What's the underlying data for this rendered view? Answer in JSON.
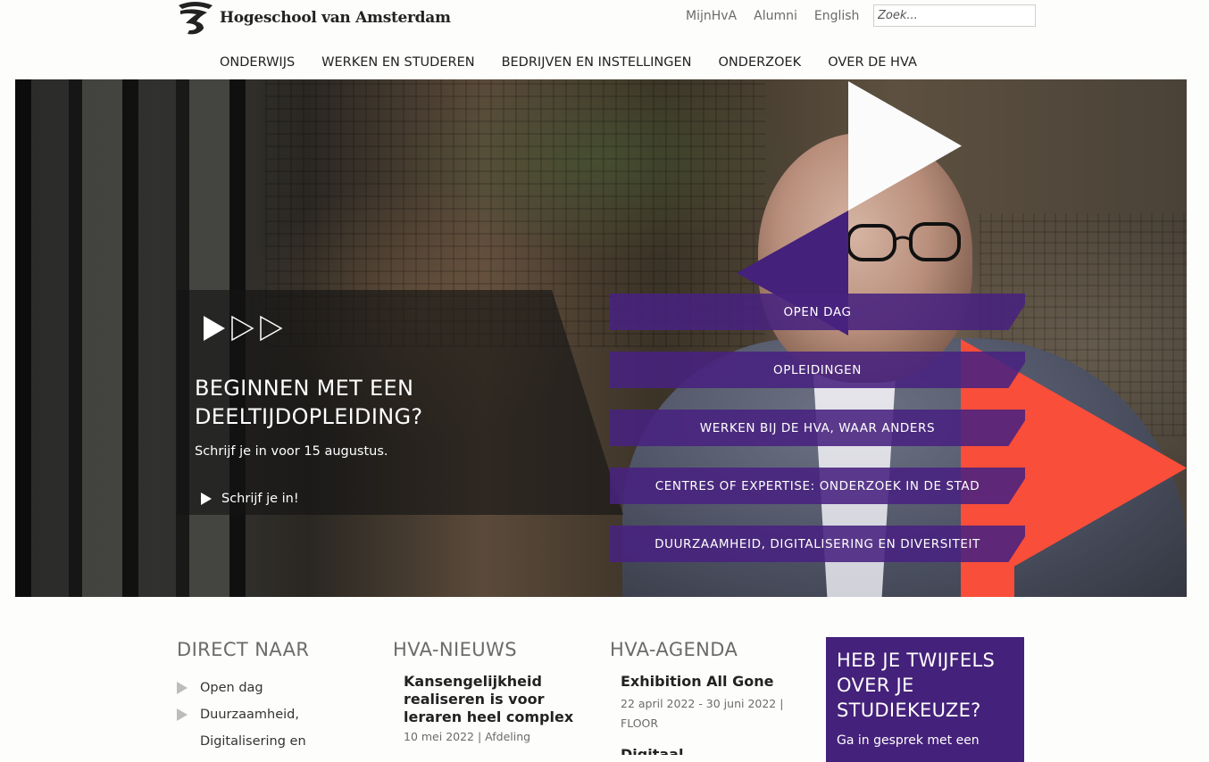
{
  "header": {
    "logo_text": "Hogeschool van Amsterdam",
    "top_links": [
      "MijnHvA",
      "Alumni",
      "English"
    ],
    "search_placeholder": "Zoek..."
  },
  "nav": {
    "items": [
      "ONDERWIJS",
      "WERKEN EN STUDEREN",
      "BEDRIJVEN EN INSTELLINGEN",
      "ONDERZOEK",
      "OVER DE HVA"
    ]
  },
  "hero": {
    "title": "BEGINNEN MET EEN DEELTIJDOPLEIDING?",
    "subtitle": "Schrijf je in voor 15 augustus.",
    "cta": "Schrijf je in!",
    "menu": [
      "OPEN DAG",
      "OPLEIDINGEN",
      "WERKEN BIJ DE HVA, WAAR ANDERS",
      "CENTRES OF EXPERTISE: ONDERZOEK IN DE STAD",
      "DUURZAAMHEID, DIGITALISERING EN DIVERSITEIT"
    ],
    "colors": {
      "purple": "#44217a",
      "orange": "#f84e3a"
    }
  },
  "direct": {
    "title": "DIRECT NAAR",
    "items": [
      "Open dag",
      "Duurzaamheid,",
      "Digitalisering en"
    ]
  },
  "news": {
    "title": "HVA-NIEUWS",
    "item_title": "Kansengelijkheid realiseren is voor leraren heel complex",
    "item_meta": "10 mei 2022 | Afdeling"
  },
  "agenda": {
    "title": "HVA-AGENDA",
    "item_title": "Exhibition All Gone",
    "item_meta": "22 april 2022 - 30 juni 2022 | FLOOR",
    "next_title": "Digitaal onderwijs"
  },
  "doubt": {
    "title": "HEB JE TWIJFELS OVER JE STUDIEKEUZE?",
    "text": "Ga in gesprek met een"
  }
}
